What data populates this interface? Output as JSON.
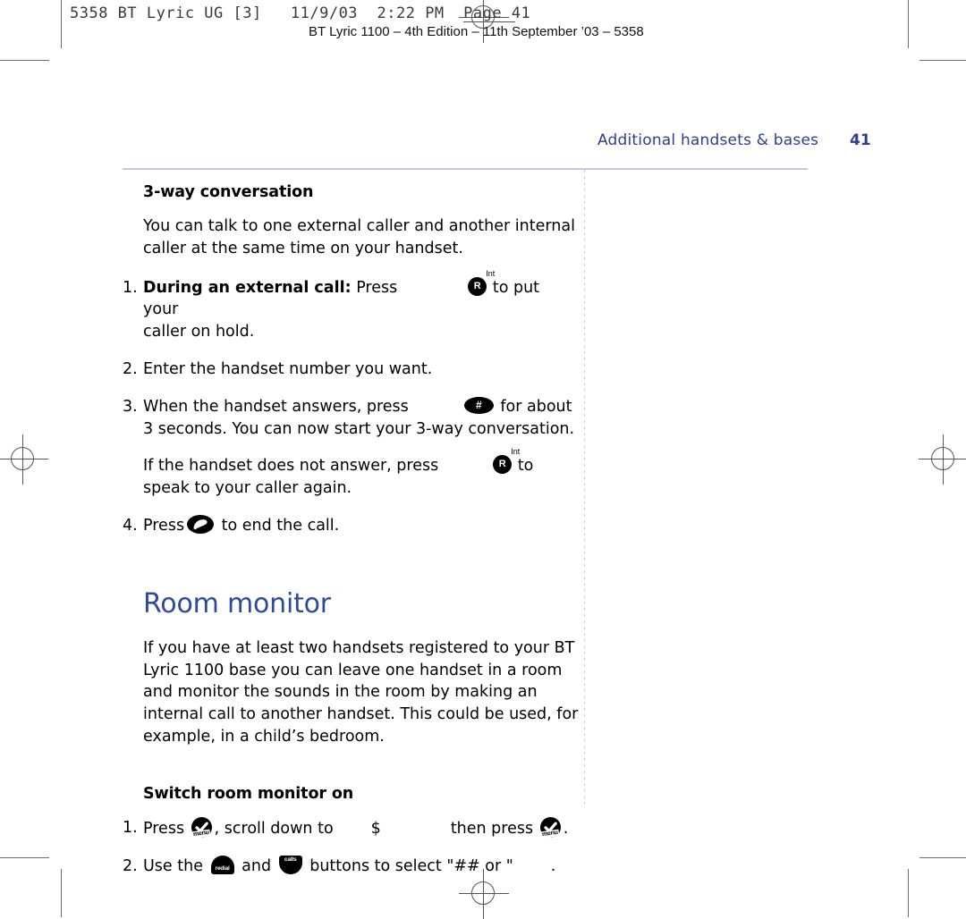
{
  "prepress": {
    "slug_top": "5358 BT Lyric UG [3]   11/9/03  2:22 PM  Page 41",
    "slug_sub": "BT Lyric 1100 – 4th Edition – 11th September ’03 – 5358"
  },
  "header": {
    "running_head": "Additional handsets & bases",
    "page_number": "41",
    "rule_color": "#c3c6e8",
    "text_color": "#2e3f8f"
  },
  "colors": {
    "heading_blue": "#2e4a9e",
    "body_black": "#000000",
    "trim_gray": "#6e6e6e"
  },
  "icons": {
    "key_r": {
      "name": "r-int-key-icon",
      "glyph": "R",
      "superscript": "Int"
    },
    "key_hash": {
      "name": "hash-key-icon",
      "glyph": "#"
    },
    "key_end": {
      "name": "end-call-key-icon",
      "glyph": "handset"
    },
    "key_menu": {
      "name": "menu-key-icon",
      "glyph": "✓",
      "label": "menu"
    },
    "key_redial": {
      "name": "redial-key-icon",
      "label": "redial"
    },
    "key_calls": {
      "name": "calls-key-icon",
      "label": "calls"
    }
  },
  "section_3way": {
    "heading": "3-way conversation",
    "intro": "You can talk to one external caller and another internal caller at the same time on your handset.",
    "steps": [
      {
        "num": "1.",
        "lead": "During an external call:",
        "text_before": " Press",
        "text_after": "to put your",
        "continuation": "caller on hold.",
        "icon": "key_r"
      },
      {
        "num": "2.",
        "text_before": "Enter the handset number you want.",
        "text_after": "",
        "icon": ""
      },
      {
        "num": "3.",
        "text_before": "When the handset answers, press",
        "text_after": "for about",
        "continuation": "3 seconds. You can now start your 3-way conversation.",
        "icon": "key_hash"
      }
    ],
    "note_before": "If the handset does not answer, press",
    "note_after": "to",
    "note_continuation": "speak to your caller again.",
    "step4_num": "4.",
    "step4_before": "Press",
    "step4_after": "to end the call."
  },
  "section_room_monitor": {
    "heading": "Room monitor",
    "body": "If you have at least two handsets registered to your BT Lyric 1100 base you can leave one handset in a room and monitor the sounds in the room by making an internal call to another handset. This could be used, for example, in a child’s bedroom.",
    "sub_heading": "Switch room monitor on",
    "steps": [
      {
        "num": "1.",
        "part1": "Press",
        "part2": ", scroll down to",
        "menu_target": "$",
        "part3": "then press",
        "part4": "."
      },
      {
        "num": "2.",
        "part1": "Use the",
        "part2": "and",
        "part3": "buttons to select \"##",
        "part4": "or \"",
        "part5": "."
      }
    ]
  }
}
